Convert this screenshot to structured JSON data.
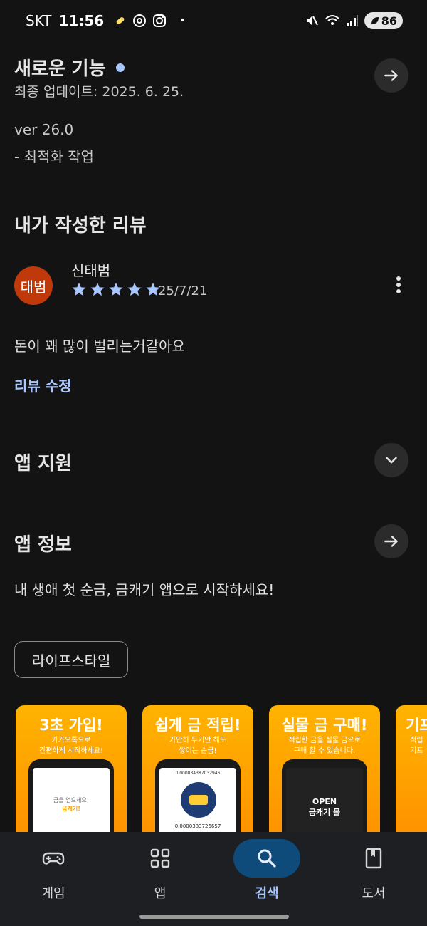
{
  "status_bar": {
    "carrier": "SKT",
    "time": "11:56",
    "dot": "•",
    "battery": "86"
  },
  "whats_new": {
    "title": "새로운 기능",
    "updated": "최종 업데이트: 2025. 6. 25.",
    "version": "ver 26.0",
    "notes": "- 최적화 작업"
  },
  "my_review": {
    "title": "내가 작성한 리뷰",
    "avatar_text": "태범",
    "reviewer": "신태범",
    "rating": 5,
    "date": "25/7/21",
    "body": "돈이 꽤 많이 벌리는거같아요",
    "edit_label": "리뷰 수정"
  },
  "app_support": {
    "title": "앱 지원"
  },
  "app_info": {
    "title": "앱 정보",
    "description": "내 생애 첫 순금, 금캐기 앱으로 시작하세요!",
    "category_chip": "라이프스타일"
  },
  "screenshots": [
    {
      "title": "3초 가입!",
      "subtitle": "카카오톡으로\n간편하게 시작하세요!",
      "screen_text": "금을 얻으세요!",
      "screen_highlight": "금캐기!"
    },
    {
      "title": "쉽게 금 적립!",
      "subtitle": "가만히 두기만 해도\n쌓이는 순금!",
      "screen_number": "0.000034387032946",
      "screen_number2": "0.0000383726657"
    },
    {
      "title": "실물 금 구매!",
      "subtitle": "적립한 금을 실물 금으로\n구매 할 수 있습니다.",
      "screen_text": "OPEN",
      "screen_highlight": "금캐기 몰"
    },
    {
      "title": "기프",
      "subtitle": "적립\n기프"
    }
  ],
  "bottom_nav": {
    "items": [
      {
        "label": "게임",
        "icon": "gamepad-icon",
        "active": false
      },
      {
        "label": "앱",
        "icon": "apps-grid-icon",
        "active": false
      },
      {
        "label": "검색",
        "icon": "search-icon",
        "active": true
      },
      {
        "label": "도서",
        "icon": "book-icon",
        "active": false
      }
    ]
  },
  "colors": {
    "background": "#131313",
    "accent": "#a9c7ff",
    "avatar": "#c0390b",
    "nav_active": "#0e4a7a",
    "card_gradient_top": "#ffb300"
  }
}
